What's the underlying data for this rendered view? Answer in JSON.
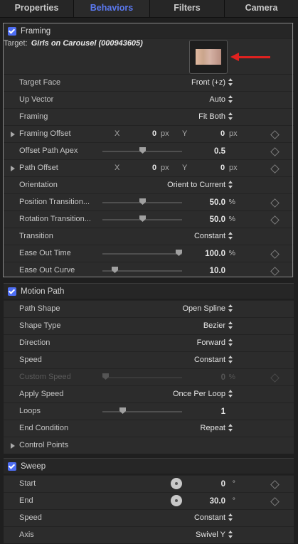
{
  "tabs": [
    "Properties",
    "Behaviors",
    "Filters",
    "Camera"
  ],
  "framing": {
    "header": "Framing",
    "target_label": "Target:",
    "target_value": "Girls on Carousel (000943605)",
    "target_face": {
      "label": "Target Face",
      "value": "Front (+z)"
    },
    "up_vector": {
      "label": "Up Vector",
      "value": "Auto"
    },
    "framing": {
      "label": "Framing",
      "value": "Fit Both"
    },
    "framing_offset": {
      "label": "Framing Offset",
      "x_label": "X",
      "x": "0",
      "x_unit": "px",
      "y_label": "Y",
      "y": "0",
      "y_unit": "px"
    },
    "offset_path_apex": {
      "label": "Offset Path Apex",
      "value": "0.5",
      "level": 0.5
    },
    "path_offset": {
      "label": "Path Offset",
      "x_label": "X",
      "x": "0",
      "x_unit": "px",
      "y_label": "Y",
      "y": "0",
      "y_unit": "px"
    },
    "orientation": {
      "label": "Orientation",
      "value": "Orient to Current"
    },
    "position_transition": {
      "label": "Position Transition...",
      "value": "50.0",
      "unit": "%",
      "level": 0.5
    },
    "rotation_transition": {
      "label": "Rotation Transition...",
      "value": "50.0",
      "unit": "%",
      "level": 0.5
    },
    "transition": {
      "label": "Transition",
      "value": "Constant"
    },
    "ease_out_time": {
      "label": "Ease Out Time",
      "value": "100.0",
      "unit": "%",
      "level": 1.0
    },
    "ease_out_curve": {
      "label": "Ease Out Curve",
      "value": "10.0",
      "level": 0.1
    }
  },
  "motion_path": {
    "header": "Motion Path",
    "path_shape": {
      "label": "Path Shape",
      "value": "Open Spline"
    },
    "shape_type": {
      "label": "Shape Type",
      "value": "Bezier"
    },
    "direction": {
      "label": "Direction",
      "value": "Forward"
    },
    "speed": {
      "label": "Speed",
      "value": "Constant"
    },
    "custom_speed": {
      "label": "Custom Speed",
      "value": "0",
      "unit": "%",
      "level": 0
    },
    "apply_speed": {
      "label": "Apply Speed",
      "value": "Once Per Loop"
    },
    "loops": {
      "label": "Loops",
      "value": "1",
      "level": 0.2
    },
    "end_condition": {
      "label": "End Condition",
      "value": "Repeat"
    },
    "control_points": {
      "label": "Control Points"
    }
  },
  "sweep": {
    "header": "Sweep",
    "start": {
      "label": "Start",
      "value": "0",
      "unit": "°"
    },
    "end": {
      "label": "End",
      "value": "30.0",
      "unit": "°"
    },
    "speed": {
      "label": "Speed",
      "value": "Constant"
    },
    "axis": {
      "label": "Axis",
      "value": "Swivel Y"
    }
  },
  "colors": {
    "accent": "#5b79f0",
    "checkbox": "#4d6df2",
    "annotation_arrow": "#e0211f"
  }
}
